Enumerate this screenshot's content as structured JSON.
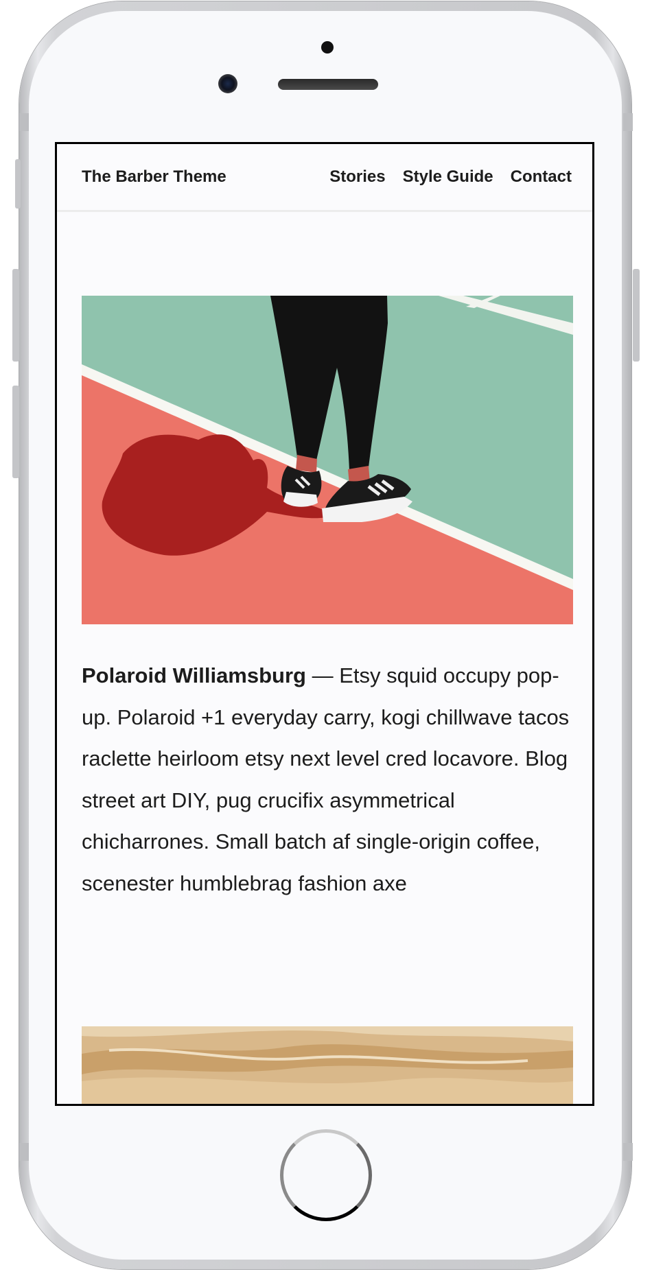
{
  "site": {
    "title": "The Barber Theme",
    "nav": [
      "Stories",
      "Style Guide",
      "Contact"
    ]
  },
  "post": {
    "title": "Polaroid Williamsburg",
    "separator": " — ",
    "excerpt": "Etsy squid occupy pop-up. Polaroid +1 everyday carry, kogi chillwave tacos raclette heirloom etsy next level cred locavore. Blog street art DIY, pug crucifix asymmetrical chicharrones. Small batch af single-origin coffee, scenester humblebrag fashion axe"
  },
  "colors": {
    "court_green": "#8fc3ad",
    "court_red": "#ec7468",
    "shadow": "#a8201f",
    "sand": "#d9b88a"
  }
}
